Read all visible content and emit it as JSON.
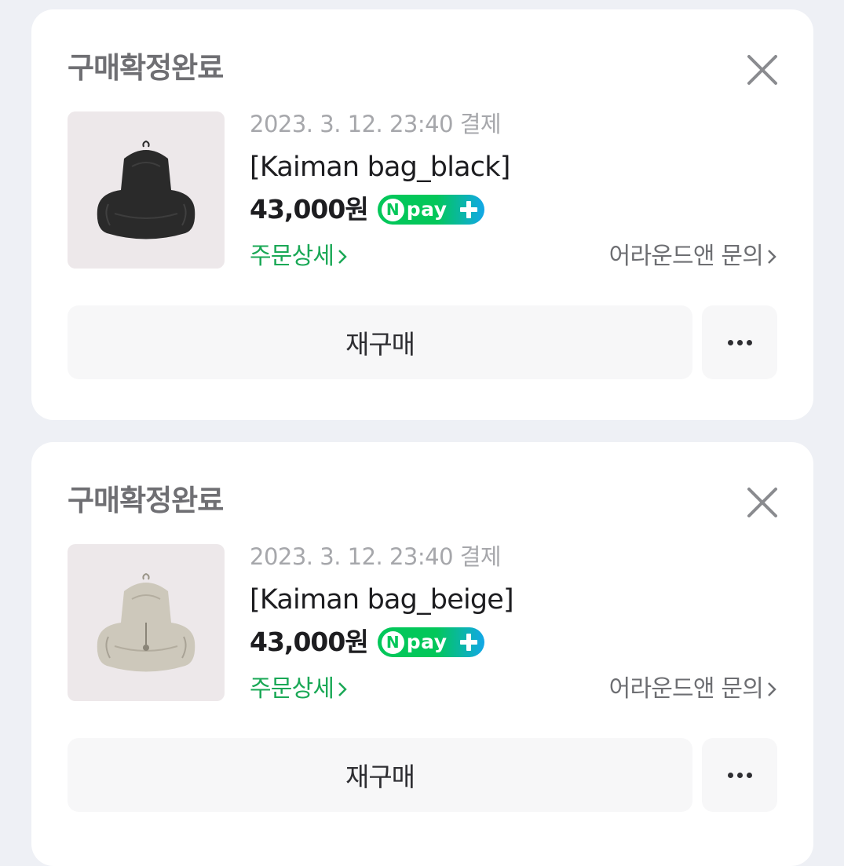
{
  "orders": [
    {
      "status": "구매확정완료",
      "payment_date": "2023. 3. 12. 23:40 결제",
      "product_name": "[Kaiman bag_black]",
      "price": "43,000원",
      "pay_badge": {
        "letter": "N",
        "text": "pay",
        "icon": "npay-plus-logo"
      },
      "order_detail_link": "주문상세",
      "inquiry_link": "어라운드앤 문의",
      "rebuy_label": "재구매",
      "more_icon": "more-dots-icon",
      "close_icon": "close-icon",
      "product_color": "#2a2a2a"
    },
    {
      "status": "구매확정완료",
      "payment_date": "2023. 3. 12. 23:40 결제",
      "product_name": "[Kaiman bag_beige]",
      "price": "43,000원",
      "pay_badge": {
        "letter": "N",
        "text": "pay",
        "icon": "npay-plus-logo"
      },
      "order_detail_link": "주문상세",
      "inquiry_link": "어라운드앤 문의",
      "rebuy_label": "재구매",
      "more_icon": "more-dots-icon",
      "close_icon": "close-icon",
      "product_color": "#cdc8bb"
    }
  ],
  "colors": {
    "page_background": "#eef0f5",
    "card_background": "#ffffff",
    "link_green": "#1aa856",
    "npay_green": "#03c75a",
    "npay_blue": "#12a7e8"
  }
}
